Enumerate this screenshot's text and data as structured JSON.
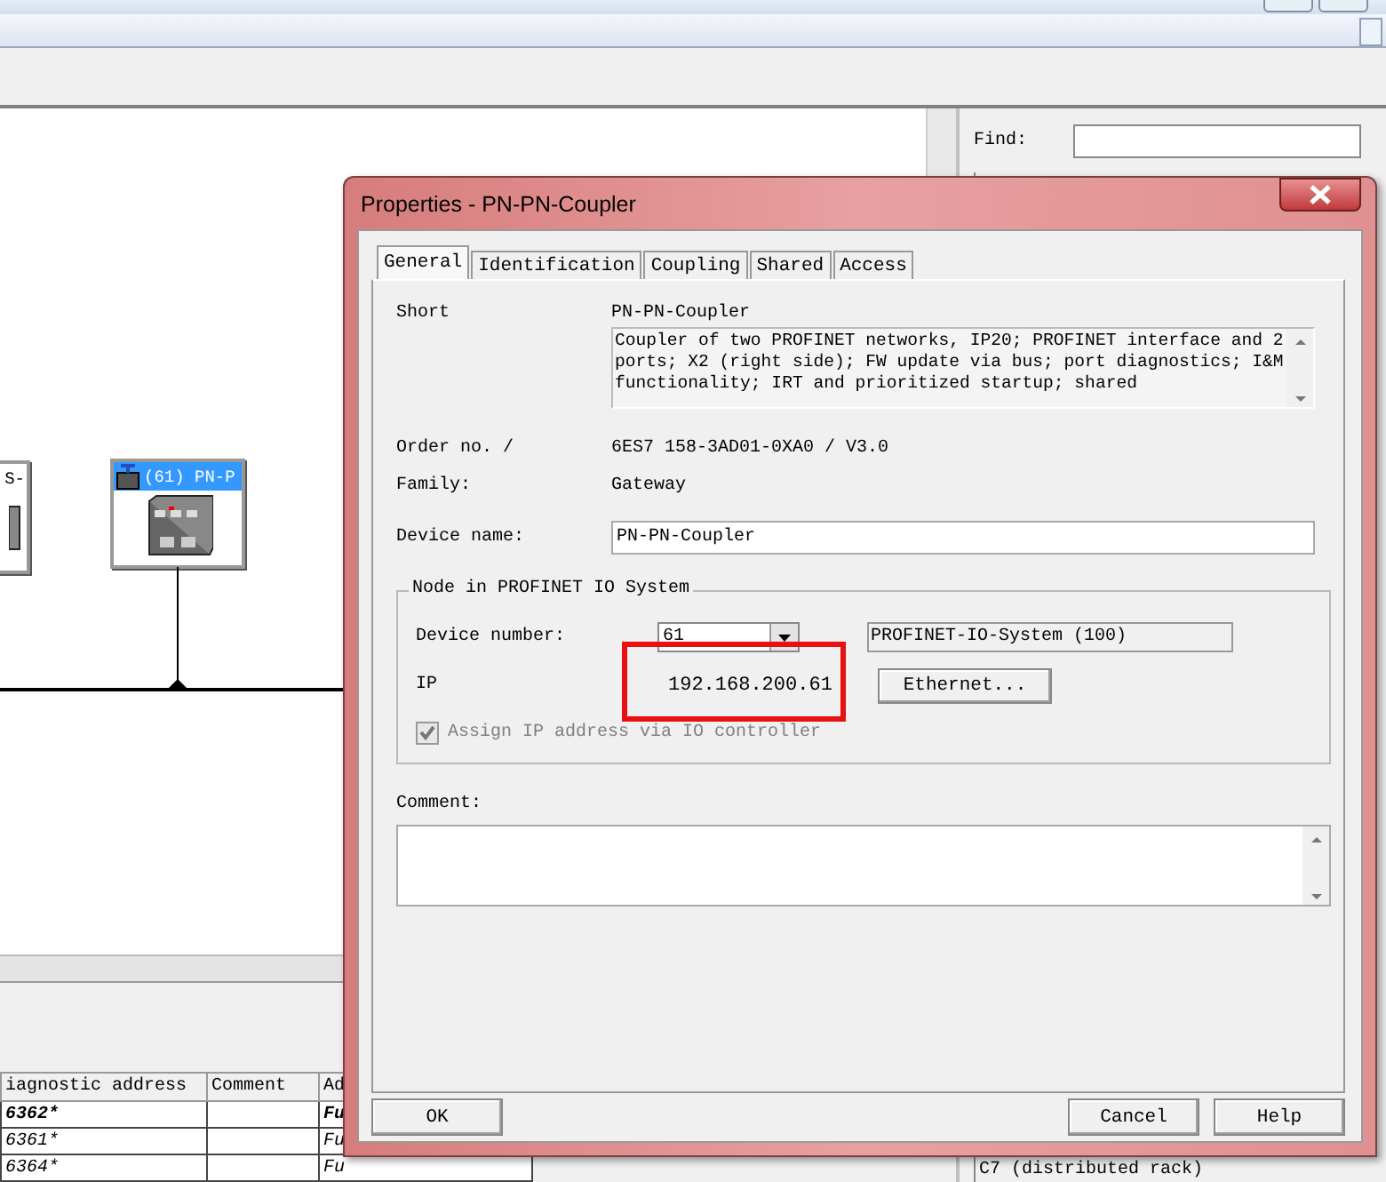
{
  "app": {
    "nodes": [
      {
        "label": "S-",
        "selected": false
      },
      {
        "label": "(61) PN-P",
        "selected": true
      }
    ],
    "table": {
      "columns": [
        "iagnostic address",
        "Comment",
        "Ad"
      ],
      "rows": [
        {
          "cells": [
            "6362*",
            "",
            "Fu"
          ],
          "highlighted": true
        },
        {
          "cells": [
            "6361*",
            "",
            "Fu"
          ],
          "highlighted": false
        },
        {
          "cells": [
            "6364*",
            "",
            "Fu"
          ],
          "highlighted": false
        }
      ]
    },
    "find_label": "Find:",
    "catalog_item": "C7 (distributed rack)"
  },
  "dialog": {
    "title": "Properties - PN-PN-Coupler",
    "tabs": [
      {
        "label": "General",
        "selected": true
      },
      {
        "label": "Identification",
        "selected": false
      },
      {
        "label": "Coupling",
        "selected": false
      },
      {
        "label": "Shared",
        "selected": false
      },
      {
        "label": "Access",
        "selected": false
      }
    ],
    "short_label": "Short",
    "short_value": "PN-PN-Coupler",
    "description": "Coupler of two PROFINET networks, IP20; PROFINET interface and 2 ports; X2 (right side); FW update via bus; port diagnostics; I&M functionality; IRT and prioritized startup; shared",
    "order_label": "Order no. /",
    "order_value": "6ES7 158-3AD01-0XA0 / V3.0",
    "family_label": "Family:",
    "family_value": "Gateway",
    "device_name_label": "Device name:",
    "device_name_value": "PN-PN-Coupler",
    "group": {
      "title": "Node in PROFINET IO System",
      "device_number_label": "Device number:",
      "device_number_value": "61",
      "io_system": "PROFINET-IO-System (100)",
      "ip_label": "IP",
      "ip_value": "192.168.200.61",
      "ethernet_button": "Ethernet...",
      "assign_ip": {
        "label": "Assign IP address via IO controller",
        "checked": true,
        "disabled": true
      }
    },
    "comment_label": "Comment:",
    "buttons": [
      {
        "label": "OK",
        "kind": "left"
      },
      {
        "label": "Cancel",
        "kind": "right"
      },
      {
        "label": "Help",
        "kind": "right"
      }
    ],
    "highlight": true
  }
}
